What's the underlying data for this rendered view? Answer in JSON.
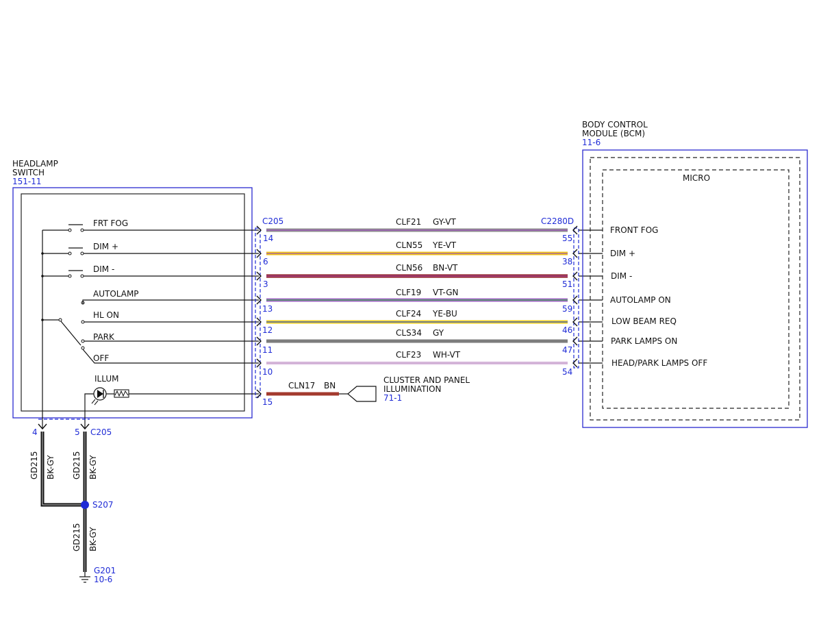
{
  "headlamp_switch": {
    "title_line1": "HEADLAMP",
    "title_line2": "SWITCH",
    "ref": "151-11",
    "positions": {
      "frt_fog": "FRT FOG",
      "dim_plus": "DIM +",
      "dim_minus": "DIM -",
      "autolamp": "AUTOLAMP",
      "hl_on": "HL ON",
      "park": "PARK",
      "off": "OFF",
      "illum": "ILLUM"
    }
  },
  "bcm": {
    "title_line1": "BODY CONTROL",
    "title_line2": "MODULE (BCM)",
    "ref": "11-6",
    "inner_label": "MICRO",
    "inputs": {
      "front_fog": "FRONT FOG",
      "dim_plus": "DIM +",
      "dim_minus": "DIM -",
      "autolamp_on": "AUTOLAMP ON",
      "low_beam_req": "LOW BEAM REQ",
      "park_lamps_on": "PARK LAMPS ON",
      "head_park_off": "HEAD/PARK LAMPS OFF"
    }
  },
  "connectors": {
    "left": "C205",
    "right": "C2280D",
    "bottom": "C205"
  },
  "wires": {
    "w1": {
      "circuit": "CLF21",
      "color": "GY-VT",
      "pin_left": "14",
      "pin_right": "55"
    },
    "w2": {
      "circuit": "CLN55",
      "color": "YE-VT",
      "pin_left": "6",
      "pin_right": "38"
    },
    "w3": {
      "circuit": "CLN56",
      "color": "BN-VT",
      "pin_left": "3",
      "pin_right": "51"
    },
    "w4": {
      "circuit": "CLF19",
      "color": "VT-GN",
      "pin_left": "13",
      "pin_right": "59"
    },
    "w5": {
      "circuit": "CLF24",
      "color": "YE-BU",
      "pin_left": "12",
      "pin_right": "46"
    },
    "w6": {
      "circuit": "CLS34",
      "color": "GY",
      "pin_left": "11",
      "pin_right": "47"
    },
    "w7": {
      "circuit": "CLF23",
      "color": "WH-VT",
      "pin_left": "10",
      "pin_right": "54"
    },
    "illum": {
      "circuit": "CLN17",
      "color": "BN",
      "pin_left": "15"
    }
  },
  "cluster": {
    "line1": "CLUSTER AND PANEL",
    "line2": "ILLUMINATION",
    "ref": "71-1"
  },
  "ground": {
    "pin_a": "4",
    "pin_b": "5",
    "circuit": "GD215",
    "color": "BK-GY",
    "splice": "S207",
    "ground_name": "G201",
    "ground_ref": "10-6"
  }
}
